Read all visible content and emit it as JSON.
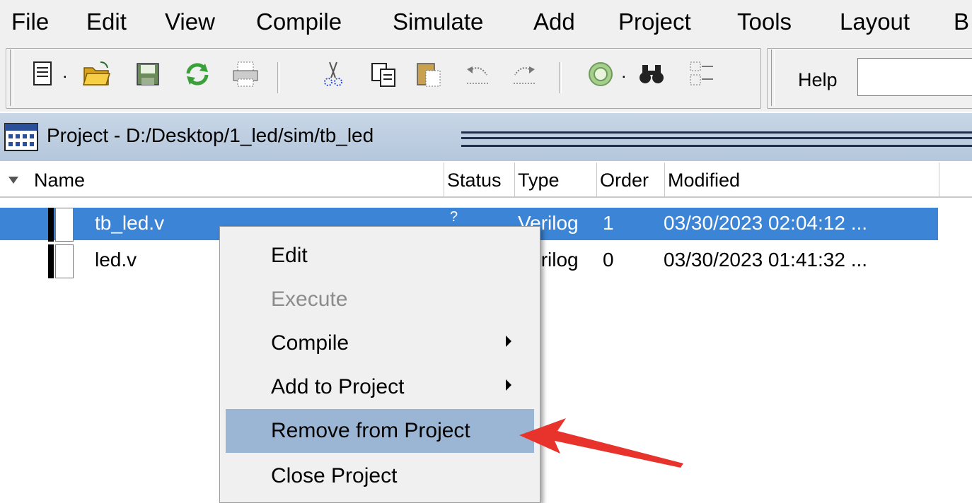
{
  "menubar": {
    "items": [
      {
        "label": "File"
      },
      {
        "label": "Edit"
      },
      {
        "label": "View"
      },
      {
        "label": "Compile"
      },
      {
        "label": "Simulate"
      },
      {
        "label": "Add"
      },
      {
        "label": "Project"
      },
      {
        "label": "Tools"
      },
      {
        "label": "Layout"
      },
      {
        "label": "B"
      }
    ]
  },
  "toolbar": {
    "icons": [
      "new-file-icon",
      "open-folder-icon",
      "save-icon",
      "reload-icon",
      "print-icon",
      "cut-icon",
      "copy-icon",
      "paste-icon",
      "undo-icon",
      "redo-icon",
      "compile-icon",
      "find-icon",
      "find-in-files-icon"
    ],
    "help_label": "Help",
    "help_value": ""
  },
  "project_pane": {
    "title": "Project - D:/Desktop/1_led/sim/tb_led"
  },
  "table": {
    "columns": [
      "Name",
      "Status",
      "Type",
      "Order",
      "Modified"
    ],
    "rows": [
      {
        "name": "tb_led.v",
        "status": "?",
        "type": "Verilog",
        "order": "1",
        "modified": "03/30/2023 02:04:12 ...",
        "selected": true
      },
      {
        "name": "led.v",
        "status": "",
        "type": "Verilog",
        "order": "0",
        "modified": "03/30/2023 01:41:32 ...",
        "selected": false
      }
    ]
  },
  "context_menu": {
    "items": [
      {
        "label": "Edit",
        "enabled": true,
        "submenu": false
      },
      {
        "label": "Execute",
        "enabled": false,
        "submenu": false
      },
      {
        "label": "Compile",
        "enabled": true,
        "submenu": true
      },
      {
        "label": "Add to Project",
        "enabled": true,
        "submenu": true
      },
      {
        "label": "Remove from Project",
        "enabled": true,
        "submenu": false,
        "highlighted": true
      },
      {
        "label": "Close Project",
        "enabled": true,
        "submenu": false
      }
    ]
  },
  "colors": {
    "selection": "#3b84d6",
    "menu_highlight": "#9bb6d4",
    "annotation_arrow": "#e8322c"
  }
}
